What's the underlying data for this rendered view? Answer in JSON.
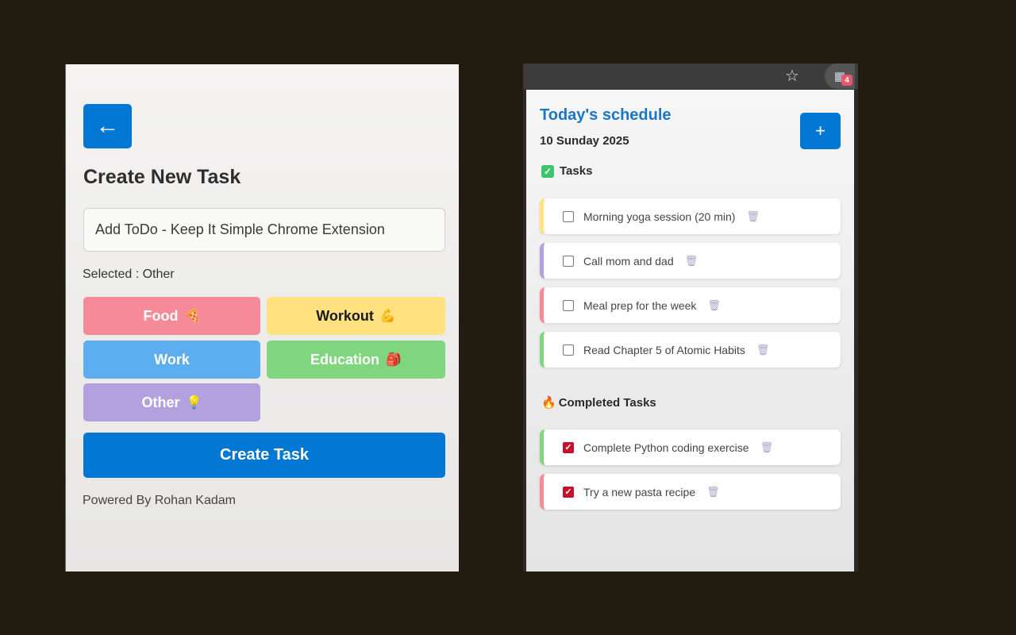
{
  "create": {
    "back_label": "←",
    "title": "Create New Task",
    "input_value": "Add ToDo - Keep It Simple Chrome Extension",
    "selected_text": "Selected : Other",
    "categories": [
      {
        "label": "Food",
        "emoji": "🍕",
        "color": "#f58b98"
      },
      {
        "label": "Workout",
        "emoji": "💪",
        "color": "#ffe27f"
      },
      {
        "label": "Work",
        "emoji": "",
        "color": "#5daef0"
      },
      {
        "label": "Education",
        "emoji": "🎒",
        "color": "#7fd67f"
      },
      {
        "label": "Other",
        "emoji": "💡",
        "color": "#b3a0de"
      }
    ],
    "create_button": "Create Task",
    "powered_by": "Powered By Rohan Kadam",
    "accent": "#0277d4"
  },
  "browser": {
    "star_icon": "☆",
    "extension_badge": "4"
  },
  "schedule": {
    "title": "Today's schedule",
    "date": "10 Sunday 2025",
    "add_label": "+",
    "tasks_heading": "Tasks",
    "completed_heading": "Completed Tasks",
    "tasks": [
      {
        "text": "Morning yoga session (20 min)",
        "color": "#ffe27f",
        "done": false
      },
      {
        "text": "Call mom and dad",
        "color": "#b3a0de",
        "done": false
      },
      {
        "text": "Meal prep for the week",
        "color": "#f58b98",
        "done": false
      },
      {
        "text": "Read Chapter 5 of Atomic Habits",
        "color": "#7fd67f",
        "done": false
      }
    ],
    "completed": [
      {
        "text": "Complete Python coding exercise",
        "color": "#7fd67f",
        "done": true
      },
      {
        "text": "Try a new pasta recipe",
        "color": "#f58b98",
        "done": true
      }
    ]
  }
}
